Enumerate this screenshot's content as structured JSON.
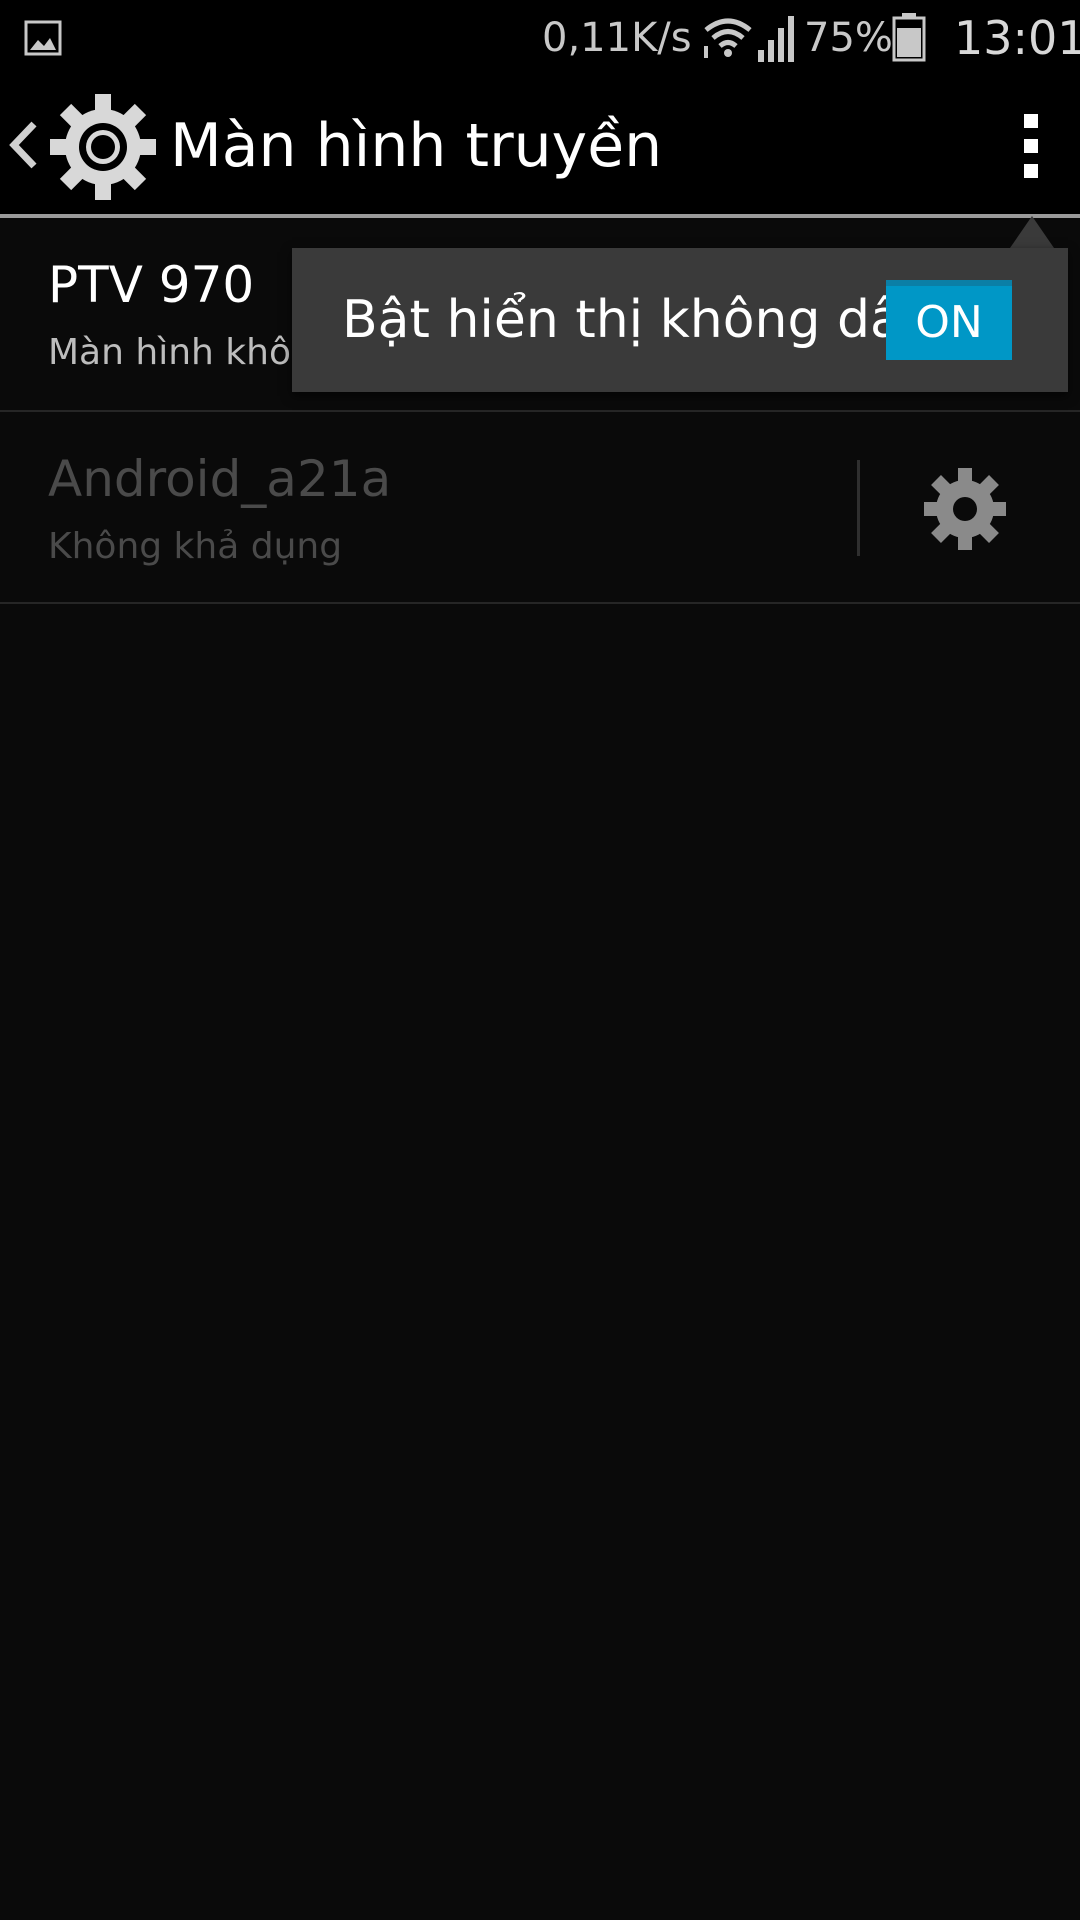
{
  "status_bar": {
    "network_speed": "0,11K/s",
    "battery_percent": "75%",
    "time": "13:01",
    "icons": [
      "gallery-notification-icon",
      "wifi-icon",
      "signal-icon",
      "battery-icon"
    ]
  },
  "action_bar": {
    "title": "Màn hình truyền",
    "icons": [
      "back-icon",
      "settings-gear-icon",
      "overflow-menu-icon"
    ]
  },
  "devices": [
    {
      "name": "PTV 970",
      "status": "Màn hình khô"
    },
    {
      "name": "Android_a21a",
      "status": "Không khả dụng"
    }
  ],
  "popup_menu": {
    "label": "Bật hiển thị không dây",
    "toggle_text": "ON",
    "toggle_on": true
  },
  "colors": {
    "background": "#0a0a0a",
    "bar_background": "#000000",
    "accent": "#0097c6",
    "popup_background": "#3a3a3a",
    "disabled_text": "#4a4a4a"
  }
}
